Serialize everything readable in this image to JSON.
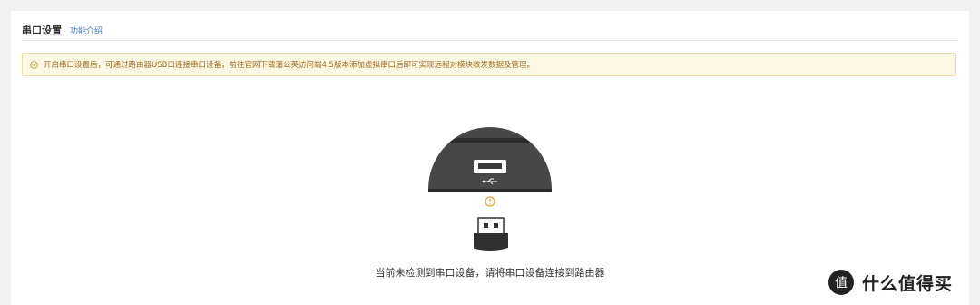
{
  "header": {
    "title": "串口设置",
    "help_link": "功能介绍"
  },
  "notice": {
    "text": "开启串口设置后，可通过路由器USB口连接串口设备，前往官网下载蒲公英访问端4.5版本添加虚拟串口后即可实现远程对模块收发数据及管理。",
    "icon": "info-circle-icon",
    "accent": "#a06a1f"
  },
  "status": {
    "message": "当前未检测到串口设备，请将串口设备连接到路由器"
  },
  "illustration": {
    "icon": "usb-disconnected-icon"
  },
  "watermark": {
    "text": "什么值得买",
    "logo_glyph": "值"
  }
}
